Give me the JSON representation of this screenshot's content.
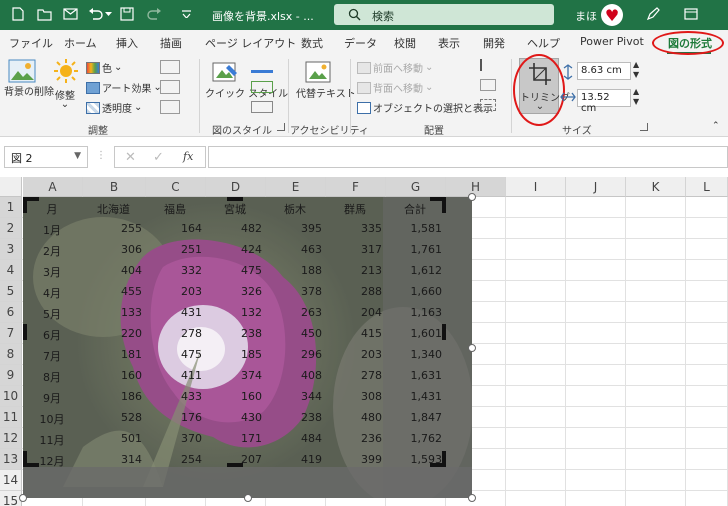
{
  "titlebar": {
    "title": "画像を背景.xlsx - ...",
    "search_label": "検索",
    "user": "まほ"
  },
  "tabs": [
    "ファイル",
    "ホーム",
    "挿入",
    "描画",
    "ページ レイアウト",
    "数式",
    "データ",
    "校閲",
    "表示",
    "開発",
    "ヘルプ",
    "Power Pivot",
    "図の形式"
  ],
  "active_tab": "図の形式",
  "ribbon": {
    "remove_bg": "背景の削除",
    "corrections": "修整",
    "color": "色",
    "artistic": "アート効果",
    "transparency": "透明度",
    "adjust_group": "調整",
    "quick_styles": "クイック スタイル",
    "styles_group": "図のスタイル",
    "alt_text": "代替テキスト",
    "accessibility_group": "アクセシビリティ",
    "bring_forward": "前面へ移動",
    "send_backward": "背面へ移動",
    "selection_pane": "オブジェクトの選択と表示",
    "arrange_group": "配置",
    "crop": "トリミング",
    "height": "8.63 cm",
    "width": "13.52 cm",
    "size_group": "サイズ"
  },
  "formula_bar": {
    "name_box": "図 2",
    "fx": "fx"
  },
  "columns": [
    "A",
    "B",
    "C",
    "D",
    "E",
    "F",
    "G",
    "H",
    "I",
    "J",
    "K",
    "L"
  ],
  "rows": [
    "1",
    "2",
    "3",
    "4",
    "5",
    "6",
    "7",
    "8",
    "9",
    "10",
    "11",
    "12",
    "13",
    "14",
    "15"
  ],
  "table": {
    "headers": [
      "月",
      "北海道",
      "福島",
      "宮城",
      "栃木",
      "群馬",
      "合計"
    ],
    "rows": [
      [
        "1月",
        "255",
        "164",
        "482",
        "395",
        "335",
        "1,581"
      ],
      [
        "2月",
        "306",
        "251",
        "424",
        "463",
        "317",
        "1,761"
      ],
      [
        "3月",
        "404",
        "332",
        "475",
        "188",
        "213",
        "1,612"
      ],
      [
        "4月",
        "455",
        "203",
        "326",
        "378",
        "288",
        "1,660"
      ],
      [
        "5月",
        "133",
        "431",
        "132",
        "263",
        "204",
        "1,163"
      ],
      [
        "6月",
        "220",
        "278",
        "238",
        "450",
        "415",
        "1,601"
      ],
      [
        "7月",
        "181",
        "475",
        "185",
        "296",
        "203",
        "1,340"
      ],
      [
        "8月",
        "160",
        "411",
        "374",
        "408",
        "278",
        "1,631"
      ],
      [
        "9月",
        "186",
        "433",
        "160",
        "344",
        "308",
        "1,431"
      ],
      [
        "10月",
        "528",
        "176",
        "430",
        "238",
        "480",
        "1,847"
      ],
      [
        "11月",
        "501",
        "370",
        "171",
        "484",
        "236",
        "1,762"
      ],
      [
        "12月",
        "314",
        "254",
        "207",
        "419",
        "399",
        "1,593"
      ]
    ]
  }
}
